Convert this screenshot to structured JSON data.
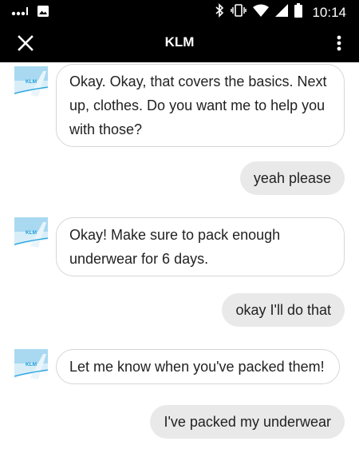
{
  "status_bar": {
    "time": "10:14",
    "icons": [
      "signal-dots-icon",
      "image-icon",
      "bluetooth-icon",
      "vibrate-icon",
      "wifi-icon",
      "cell-signal-icon",
      "battery-icon"
    ]
  },
  "app_bar": {
    "title": "KLM",
    "close_icon": "close-icon",
    "more_icon": "more-vert-icon"
  },
  "colors": {
    "bar_bg": "#000000",
    "bot_bubble_border": "#d6d6d6",
    "user_bubble_bg": "#e9e9e9",
    "klm_blue": "#1e9fdb"
  },
  "messages": [
    {
      "sender": "bot",
      "avatar_text": "KLM",
      "lines": [
        "Okay. Okay, that covers the basics. Next",
        "up, clothes. Do you want me to help you",
        "with those?"
      ]
    },
    {
      "sender": "user",
      "text": "yeah please"
    },
    {
      "sender": "bot",
      "avatar_text": "KLM",
      "lines": [
        "Okay! Make sure to pack enough",
        "underwear for 6 days."
      ]
    },
    {
      "sender": "user",
      "text": "okay I'll do that"
    },
    {
      "sender": "bot",
      "avatar_text": "KLM",
      "lines": [
        "Let me know when you've packed them!"
      ]
    },
    {
      "sender": "user",
      "text": "I've packed my underwear"
    }
  ]
}
